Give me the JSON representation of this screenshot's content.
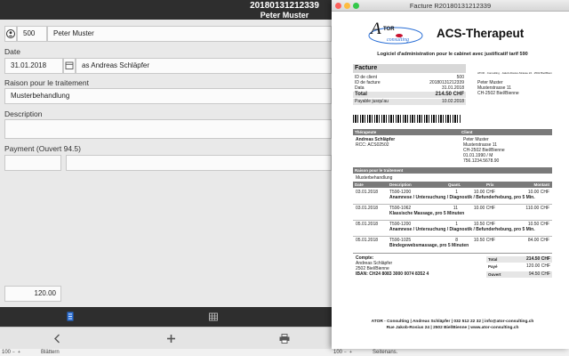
{
  "header": {
    "line1": "20180131212339",
    "line2": "Peter Muster"
  },
  "form": {
    "patient_id": "500",
    "patient_name": "Peter Muster",
    "date_label": "Date",
    "date_value": "31.01.2018",
    "date_by": "as Andreas Schläpfer",
    "reason_label": "Raison pour le traitement",
    "reason_value": "Musterbehandlung",
    "description_label": "Description",
    "payment_label": "Payment (Ouvert 94.5)",
    "total_value": "120.00"
  },
  "status_left": {
    "zoom": "100",
    "mode": "Blättern"
  },
  "status_right": {
    "zoom": "100",
    "mode": "Seitenans."
  },
  "window": {
    "title": "Facture R20180131212339"
  },
  "invoice": {
    "brand_logo": "ATOR Consulting",
    "brand_name": "ACS-Therapeut",
    "tagline": "Logiciel d'administration pour le cabinet avec justificatif tarif 590",
    "facture_title": "Facture",
    "meta": [
      {
        "label": "ID de client",
        "value": "500"
      },
      {
        "label": "ID de facture",
        "value": "20180131212339"
      },
      {
        "label": "Data",
        "value": "31.01.2018"
      }
    ],
    "total": {
      "label": "Total",
      "value": "214.50 CHF"
    },
    "payable": {
      "label": "Payable jusqu'au",
      "value": "10.02.2018"
    },
    "sender_line": "ATOR · Consulting · Jakob-Rosius-Strasse 24 · 2502 Biel/Bienne",
    "recipient": [
      "Peter Muster",
      "Musterstrasse 11",
      "CH-2502 Biel/Bienne"
    ],
    "therapist_head": "Thérapeute",
    "therapist": [
      "Andreas Schläpfer",
      "RCC: ACS02502"
    ],
    "client_head": "Client",
    "client": [
      "Peter Muster",
      "Musterstrasse 11",
      "CH-2502 Biel/Bienne",
      "01.01.1990 / M",
      "756.1234.5678.90"
    ],
    "reason_head": "Raison pour le traitement",
    "reason": "Musterbehandlung",
    "table_head": {
      "date": "Date",
      "desc": "Description",
      "qty": "Quant.",
      "price": "Prix",
      "amount": "Montant"
    },
    "rows": [
      {
        "date": "03.01.2018",
        "code": "T590-1200",
        "qty": "1",
        "price": "10.00 CHF",
        "amount": "10.00 CHF",
        "text": "Anamnese / Untersuchung / Diagnostik / Befunderhebung, pro 5 Min."
      },
      {
        "date": "03.01.2018",
        "code": "T590-1062",
        "qty": "11",
        "price": "10.00 CHF",
        "amount": "110.00 CHF",
        "text": "Klassische Massage, pro 5 Minuten"
      },
      {
        "date": "05.01.2018",
        "code": "T590-1200",
        "qty": "1",
        "price": "10.50 CHF",
        "amount": "10.50 CHF",
        "text": "Anamnese / Untersuchung / Diagnostik / Befunderhebung, pro 5 Min."
      },
      {
        "date": "05.01.2018",
        "code": "T590-1025",
        "qty": "8",
        "price": "10.50 CHF",
        "amount": "84.00 CHF",
        "text": "Bindegewebsmassage, pro 5 Minuten"
      }
    ],
    "account_label": "Compte:",
    "account": [
      "Andreas Schläpfer",
      "2502 Biel/Bienne"
    ],
    "iban": "IBAN: CH24 8083 3000 0074 8352 4",
    "sum_total": {
      "label": "Total",
      "value": "214.50 CHF"
    },
    "sum_paid": {
      "label": "Payé",
      "value": "120.00 CHF"
    },
    "sum_open": {
      "label": "Ouvert",
      "value": "94.50 CHF"
    },
    "footer1": "ATOR - Consulting | Andreas Schläpfer | 032 512 22 32 | info@ator-consulting.ch",
    "footer2": "Rue Jakob-Rosius 24 | 2502 Biel/Bienne | www.ator-consulting.ch"
  },
  "colors": {
    "dark_bar": "#2e2e2e",
    "accent_blue": "#2a6fd6",
    "logo_red": "#c8102e"
  }
}
